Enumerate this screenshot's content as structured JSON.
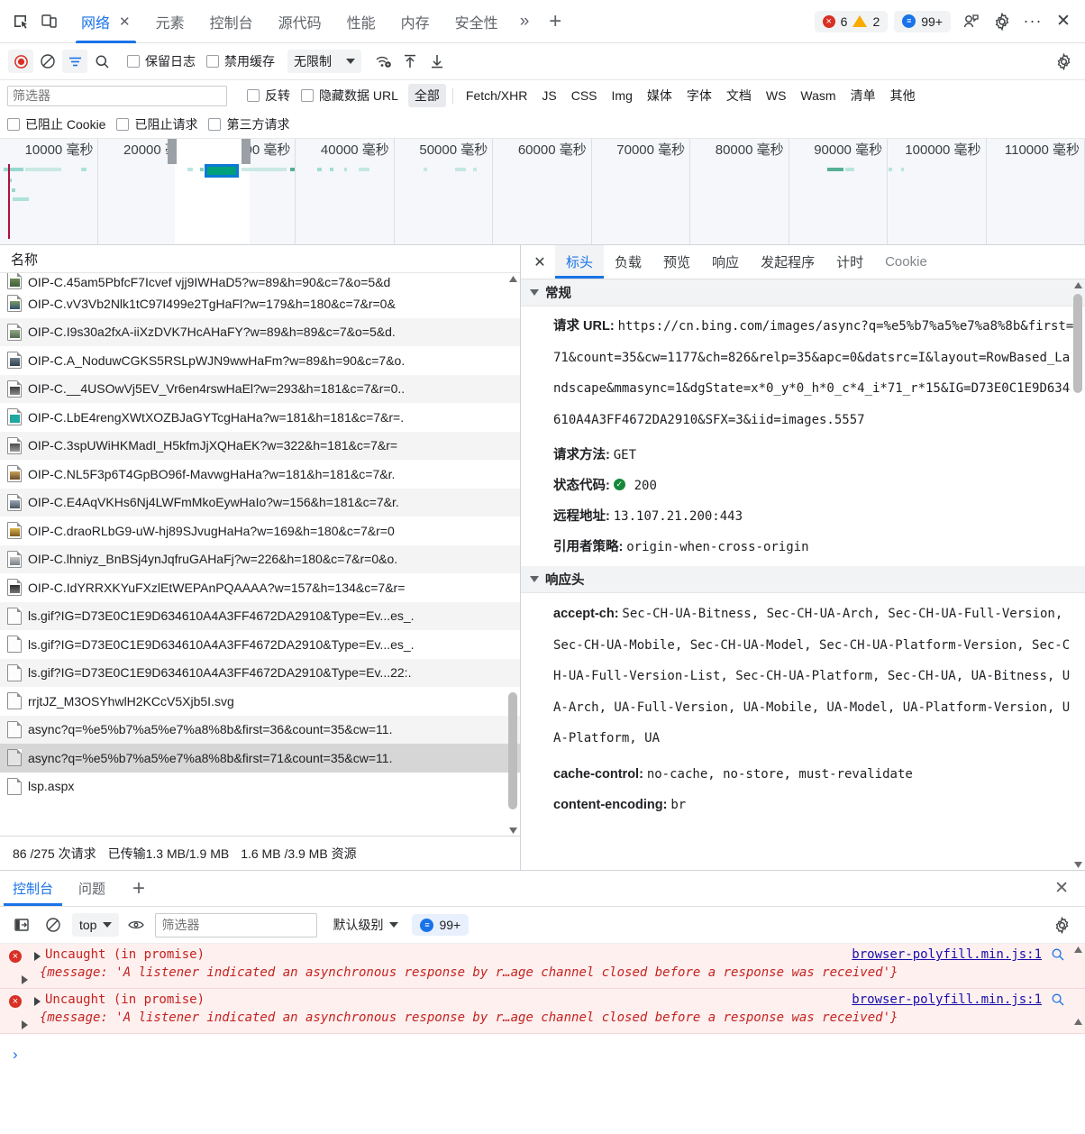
{
  "tabbar": {
    "inspect_icon": "inspect-element-icon",
    "device_icon": "device-toolbar-icon",
    "tabs": [
      {
        "label": "网络",
        "active": true,
        "closable": true
      },
      {
        "label": "元素",
        "active": false
      },
      {
        "label": "控制台",
        "active": false
      },
      {
        "label": "源代码",
        "active": false
      },
      {
        "label": "性能",
        "active": false
      },
      {
        "label": "内存",
        "active": false
      },
      {
        "label": "安全性",
        "active": false
      }
    ],
    "more_tabs": "»",
    "add_tab": "+",
    "error_count": "6",
    "warning_count": "2",
    "message_count": "99+",
    "close_label": "✕",
    "more_label": "···"
  },
  "network_toolbar": {
    "record_title": "record",
    "clear_title": "clear",
    "filter_title": "filter",
    "search_title": "search",
    "preserve_log_label": "保留日志",
    "disable_cache_label": "禁用缓存",
    "throttle_value": "无限制",
    "wifi_title": "network-conditions",
    "import_title": "import-har",
    "export_title": "export-har",
    "settings_title": "settings"
  },
  "filter_row": {
    "filter_placeholder": "筛选器",
    "invert_label": "反转",
    "hide_data_url_label": "隐藏数据 URL",
    "types": [
      {
        "label": "全部",
        "active": true
      },
      {
        "label": "Fetch/XHR",
        "active": false
      },
      {
        "label": "JS",
        "active": false
      },
      {
        "label": "CSS",
        "active": false
      },
      {
        "label": "Img",
        "active": false
      },
      {
        "label": "媒体",
        "active": false
      },
      {
        "label": "字体",
        "active": false
      },
      {
        "label": "文档",
        "active": false
      },
      {
        "label": "WS",
        "active": false
      },
      {
        "label": "Wasm",
        "active": false
      },
      {
        "label": "清单",
        "active": false
      },
      {
        "label": "其他",
        "active": false
      }
    ]
  },
  "block_row": {
    "blocked_cookies_label": "已阻止 Cookie",
    "blocked_requests_label": "已阻止请求",
    "third_party_label": "第三方请求"
  },
  "overview": {
    "ticks": [
      "10000 毫秒",
      "20000 毫秒",
      "30000 毫秒",
      "40000 毫秒",
      "50000 毫秒",
      "60000 毫秒",
      "70000 毫秒",
      "80000 毫秒",
      "90000 毫秒",
      "100000 毫秒",
      "110000 毫秒"
    ]
  },
  "requests_panel": {
    "column_header": "名称",
    "rows": [
      {
        "name": "OIP-C.45am5PbfcF7Icvef vjj9IWHaD5?w=89&h=90&c=7&o=5&d",
        "icon": "image-file-icon",
        "clipped": true,
        "selected": false
      },
      {
        "name": "OIP-C.vV3Vb2Nlk1tC97I499e2TgHaFl?w=179&h=180&c=7&r=0&",
        "icon": "image-file-icon",
        "selected": false
      },
      {
        "name": "OIP-C.I9s30a2fxA-iiXzDVK7HcAHaFY?w=89&h=89&c=7&o=5&d.",
        "icon": "image-file-icon",
        "selected": false
      },
      {
        "name": "OIP-C.A_NoduwCGKS5RSLpWJN9wwHaFm?w=89&h=90&c=7&o.",
        "icon": "image-file-icon",
        "selected": false
      },
      {
        "name": "OIP-C.__4USOwVj5EV_Vr6en4rswHaEl?w=293&h=181&c=7&r=0..",
        "icon": "image-file-icon",
        "selected": false
      },
      {
        "name": "OIP-C.LbE4rengXWtXOZBJaGYTcgHaHa?w=181&h=181&c=7&r=.",
        "icon": "image-file-icon",
        "selected": false
      },
      {
        "name": "OIP-C.3spUWiHKMadI_H5kfmJjXQHaEK?w=322&h=181&c=7&r=",
        "icon": "image-file-icon",
        "selected": false
      },
      {
        "name": "OIP-C.NL5F3p6T4GpBO96f-MavwgHaHa?w=181&h=181&c=7&r.",
        "icon": "image-file-icon",
        "selected": false
      },
      {
        "name": "OIP-C.E4AqVKHs6Nj4LWFmMkoEywHaIo?w=156&h=181&c=7&r.",
        "icon": "image-file-icon",
        "selected": false
      },
      {
        "name": "OIP-C.draoRLbG9-uW-hj89SJvugHaHa?w=169&h=180&c=7&r=0",
        "icon": "image-file-icon",
        "selected": false
      },
      {
        "name": "OIP-C.lhniyz_BnBSj4ynJqfruGAHaFj?w=226&h=180&c=7&r=0&o.",
        "icon": "image-file-icon",
        "selected": false
      },
      {
        "name": "OIP-C.IdYRRXKYuFXzlEtWEPAnPQAAAA?w=157&h=134&c=7&r=",
        "icon": "image-file-icon",
        "selected": false
      },
      {
        "name": "ls.gif?IG=D73E0C1E9D634610A4A3FF4672DA2910&Type=Ev...es_.",
        "icon": "generic-file-icon",
        "selected": false
      },
      {
        "name": "ls.gif?IG=D73E0C1E9D634610A4A3FF4672DA2910&Type=Ev...es_.",
        "icon": "generic-file-icon",
        "selected": false
      },
      {
        "name": "ls.gif?IG=D73E0C1E9D634610A4A3FF4672DA2910&Type=Ev...22:.",
        "icon": "generic-file-icon",
        "selected": false
      },
      {
        "name": "rrjtJZ_M3OSYhwlH2KCcV5Xjb5I.svg",
        "icon": "generic-file-icon",
        "selected": false
      },
      {
        "name": "async?q=%e5%b7%a5%e7%a8%8b&first=36&count=35&cw=11.",
        "icon": "generic-file-icon",
        "selected": false
      },
      {
        "name": "async?q=%e5%b7%a5%e7%a8%8b&first=71&count=35&cw=11.",
        "icon": "generic-file-icon",
        "selected": true
      },
      {
        "name": "lsp.aspx",
        "icon": "generic-file-icon",
        "selected": false
      }
    ],
    "status": {
      "requests": "86 /275 次请求",
      "transferred": "已传输1.3 MB/1.9 MB",
      "resources": "1.6 MB /3.9 MB 资源"
    }
  },
  "details_panel": {
    "close_label": "✕",
    "tabs": [
      {
        "label": "标头",
        "active": true
      },
      {
        "label": "负载",
        "active": false
      },
      {
        "label": "预览",
        "active": false
      },
      {
        "label": "响应",
        "active": false
      },
      {
        "label": "发起程序",
        "active": false
      },
      {
        "label": "计时",
        "active": false
      },
      {
        "label": "Cookie",
        "active": false,
        "dim": true
      }
    ],
    "general": {
      "section_title": "常规",
      "url_label": "请求 URL:",
      "url_value": "https://cn.bing.com/images/async?q=%e5%b7%a5%e7%a8%8b&first=71&count=35&cw=1177&ch=826&relp=35&apc=0&datsrc=I&layout=RowBased_Landscape&mmasync=1&dgState=x*0_y*0_h*0_c*4_i*71_r*15&IG=D73E0C1E9D634610A4A3FF4672DA2910&SFX=3&iid=images.5557",
      "method_label": "请求方法:",
      "method_value": "GET",
      "status_label": "状态代码:",
      "status_value": "200",
      "remote_label": "远程地址:",
      "remote_value": "13.107.21.200:443",
      "referrer_label": "引用者策略:",
      "referrer_value": "origin-when-cross-origin"
    },
    "response_headers": {
      "section_title": "响应头",
      "items": [
        {
          "name": "accept-ch:",
          "value": "Sec-CH-UA-Bitness, Sec-CH-UA-Arch, Sec-CH-UA-Full-Version, Sec-CH-UA-Mobile, Sec-CH-UA-Model, Sec-CH-UA-Platform-Version, Sec-CH-UA-Full-Version-List, Sec-CH-UA-Platform, Sec-CH-UA, UA-Bitness, UA-Arch, UA-Full-Version, UA-Mobile, UA-Model, UA-Platform-Version, UA-Platform, UA"
        },
        {
          "name": "cache-control:",
          "value": "no-cache, no-store, must-revalidate"
        },
        {
          "name": "content-encoding:",
          "value": "br"
        }
      ]
    }
  },
  "drawer": {
    "tabs": [
      {
        "label": "控制台",
        "active": true
      },
      {
        "label": "问题",
        "active": false
      }
    ],
    "add_tab": "+",
    "close_label": "✕",
    "toolbar": {
      "sidebar_title": "show-console-sidebar",
      "clear_title": "clear-console",
      "context_value": "top",
      "eye_title": "live-expressions",
      "filter_placeholder": "筛选器",
      "level_label": "默认级别",
      "issues_count": "99+",
      "settings_title": "console-settings"
    },
    "messages": [
      {
        "title": "Uncaught (in promise)",
        "source": "browser-polyfill.min.js:1",
        "body": "{message: 'A listener indicated an asynchronous response by r…age channel closed before a response was received'}"
      },
      {
        "title": "Uncaught (in promise)",
        "source": "browser-polyfill.min.js:1",
        "body": "{message: 'A listener indicated an asynchronous response by r…age channel closed before a response was received'}"
      }
    ],
    "prompt": "›"
  },
  "colors": {
    "accent": "#1a73e8",
    "error": "#d93025",
    "warning": "#f9ab00",
    "success": "#17883a",
    "selection": "#0b7ad6"
  }
}
